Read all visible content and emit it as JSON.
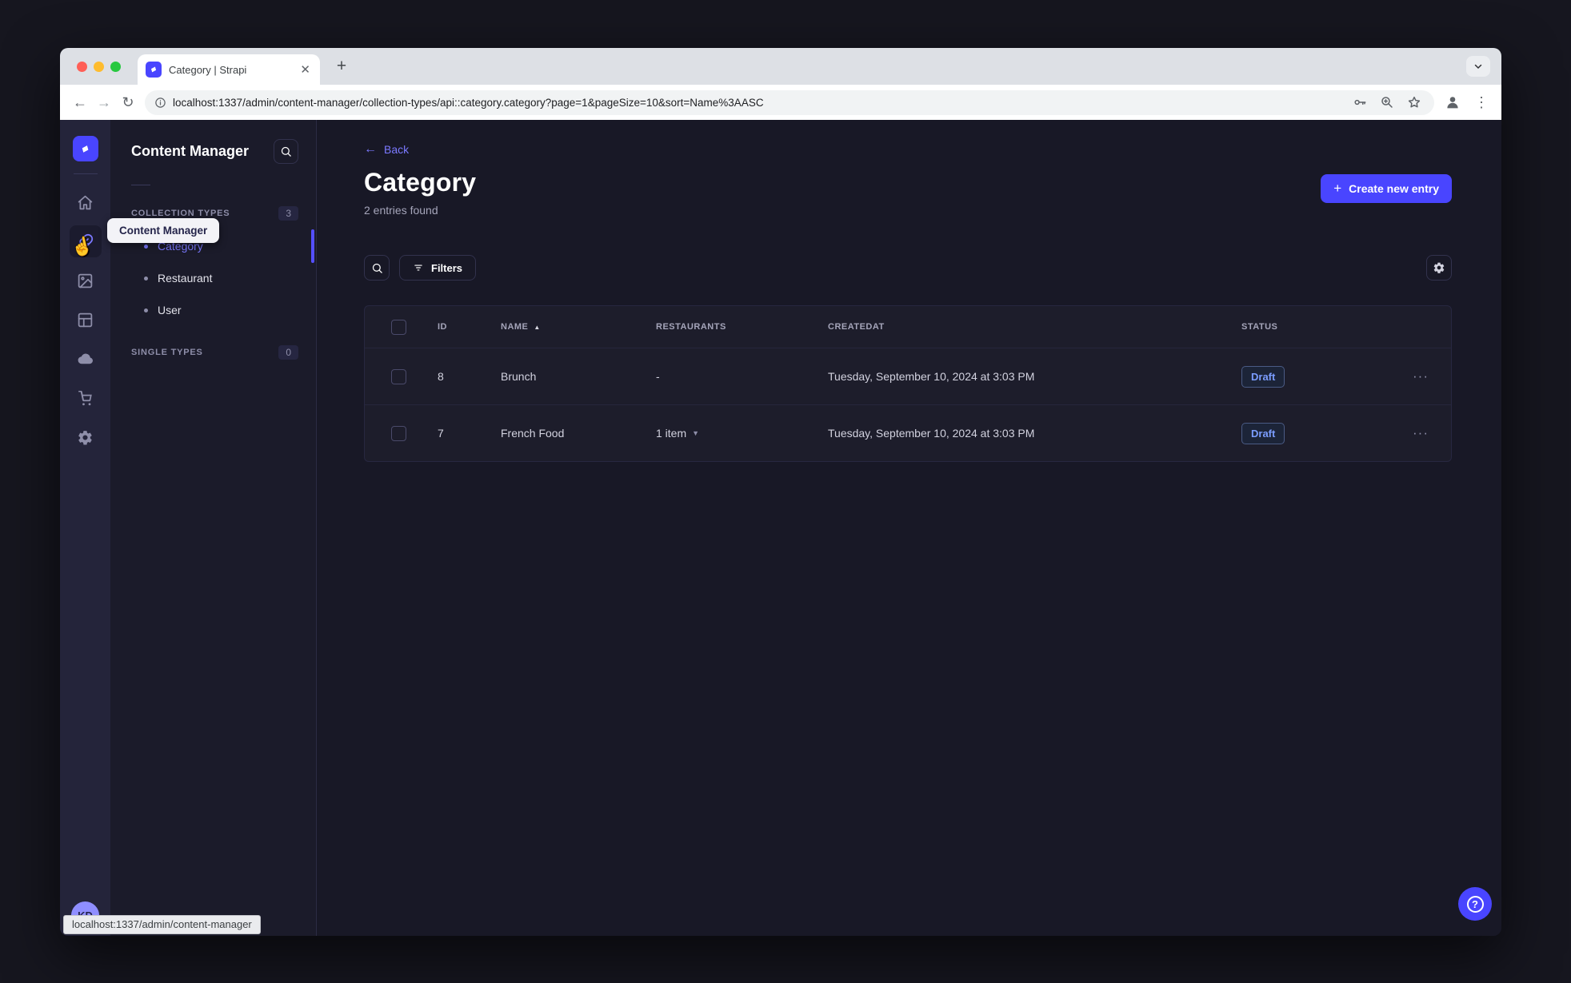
{
  "browser": {
    "tab_title": "Category | Strapi",
    "new_tab_glyph": "+",
    "url": "localhost:1337/admin/content-manager/collection-types/api::category.category?page=1&pageSize=10&sort=Name%3AASC",
    "status_text": "localhost:1337/admin/content-manager",
    "icons": [
      "back-arrow",
      "forward-arrow",
      "reload",
      "page-info",
      "password-key",
      "zoom-magnifier",
      "bookmark-star",
      "profile-avatar",
      "menu-dots",
      "tab-search-chevron"
    ]
  },
  "nav_rail": {
    "items": [
      "home",
      "content-manager",
      "media-library",
      "content-type-builder",
      "cloud",
      "marketplace",
      "settings"
    ],
    "active_item": "content-manager",
    "logo": "strapi-logo"
  },
  "sidebar": {
    "title": "Content Manager",
    "sections": [
      {
        "label": "COLLECTION TYPES",
        "count": "3",
        "items": [
          {
            "label": "Category",
            "active": true
          },
          {
            "label": "Restaurant",
            "active": false
          },
          {
            "label": "User",
            "active": false
          }
        ]
      },
      {
        "label": "SINGLE TYPES",
        "count": "0",
        "items": []
      }
    ]
  },
  "tooltip": {
    "text": "Content Manager"
  },
  "main": {
    "back_label": "Back",
    "title": "Category",
    "subtitle": "2 entries found",
    "create_label": "Create new entry",
    "filters_label": "Filters",
    "table": {
      "columns": [
        "ID",
        "NAME",
        "RESTAURANTS",
        "CREATEDAT",
        "STATUS"
      ],
      "sorted_by": "NAME",
      "sort_direction": "asc",
      "rows": [
        {
          "id": "8",
          "name": "Brunch",
          "restaurants": "-",
          "created_at": "Tuesday, September 10, 2024 at 3:03 PM",
          "status": "Draft"
        },
        {
          "id": "7",
          "name": "French Food",
          "restaurants": "1 item",
          "created_at": "Tuesday, September 10, 2024 at 3:03 PM",
          "status": "Draft"
        }
      ]
    }
  },
  "user": {
    "initials": "KD"
  },
  "colors": {
    "primary": "#4945ff",
    "primary_light": "#7b79ff",
    "page_bg": "#181826",
    "rail_bg": "#24243a",
    "sidebar_bg": "#1b1b2a",
    "draft_text": "#7b9dff"
  }
}
